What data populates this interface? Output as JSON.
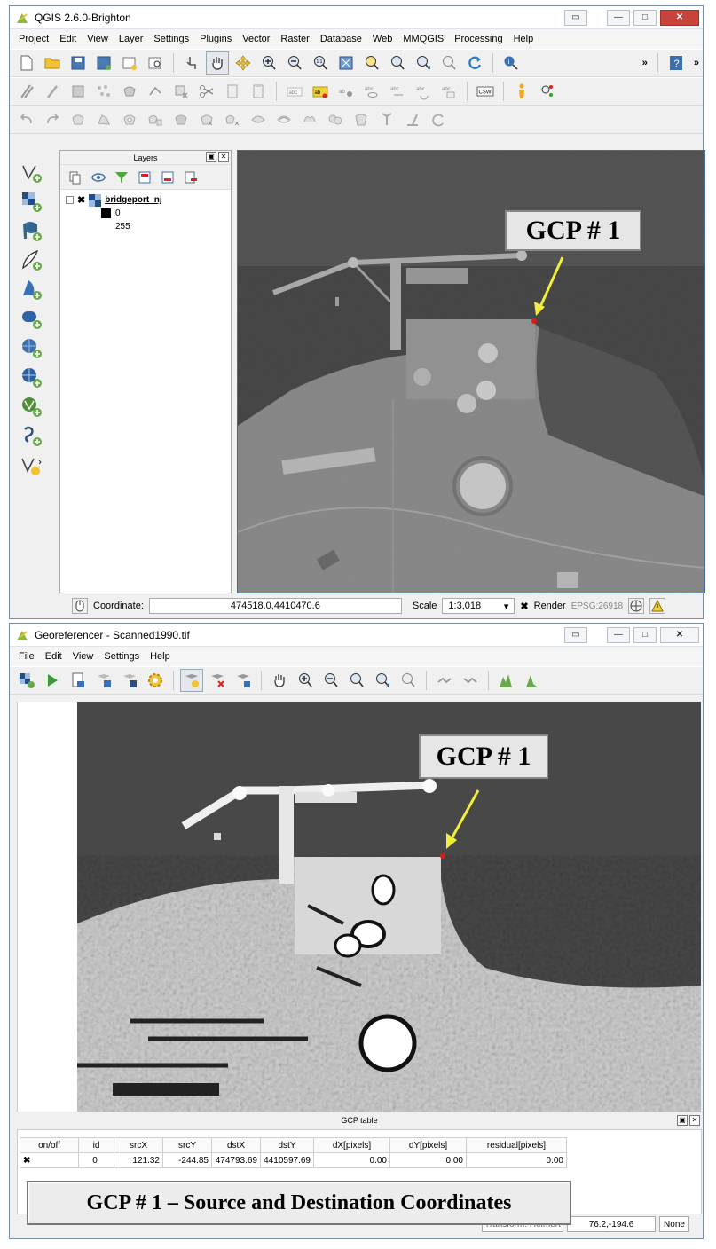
{
  "qgis": {
    "title": "QGIS 2.6.0-Brighton",
    "menu": [
      "Project",
      "Edit",
      "View",
      "Layer",
      "Settings",
      "Plugins",
      "Vector",
      "Raster",
      "Database",
      "Web",
      "MMQGIS",
      "Processing",
      "Help"
    ],
    "layers_panel": {
      "title": "Layers",
      "layer_name": "bridgeport_nj",
      "legend_min": "0",
      "legend_max": "255"
    },
    "status": {
      "coordinate_label": "Coordinate:",
      "coordinate_value": "474518.0,4410470.6",
      "scale_label": "Scale",
      "scale_value": "1:3,018",
      "render_label": "Render",
      "crs": "EPSG:26918"
    }
  },
  "georef": {
    "title": "Georeferencer - Scanned1990.tif",
    "menu": [
      "File",
      "Edit",
      "View",
      "Settings",
      "Help"
    ],
    "gcp_table": {
      "title": "GCP table",
      "columns": [
        "on/off",
        "id",
        "srcX",
        "srcY",
        "dstX",
        "dstY",
        "dX[pixels]",
        "dY[pixels]",
        "residual[pixels]"
      ],
      "rows": [
        [
          "",
          "0",
          "121.32",
          "-244.85",
          "474793.69",
          "4410597.69",
          "0.00",
          "0.00",
          "0.00"
        ]
      ]
    },
    "status": {
      "transform": "Transform: Helmert",
      "coords": "76.2,-194.6",
      "crs": "None"
    }
  },
  "annotations": {
    "gcp_label": "GCP # 1",
    "caption": "GCP # 1 – Source and Destination Coordinates"
  },
  "colors": {
    "arrow": "#f2ee3a",
    "gcp_point": "#e01818",
    "water": "#262626",
    "window_border": "#7a8ca4"
  }
}
